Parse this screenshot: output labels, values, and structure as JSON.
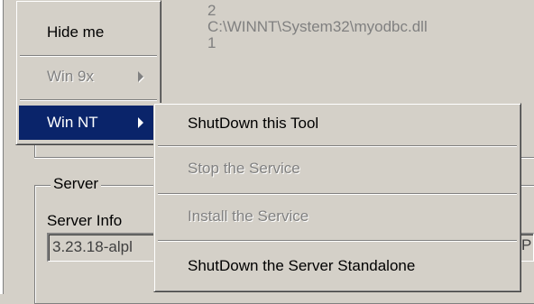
{
  "background": {
    "info_lines": [
      "2",
      "C:\\WINNT\\System32\\myodbc.dll",
      "1"
    ],
    "server_group_label": "Server",
    "server_info_label": "Server Info",
    "version_value": "3.23.18-alpl",
    "right_clip_text": "P"
  },
  "context_menu": {
    "items": [
      {
        "label": "Hide me"
      },
      {
        "label": "Win 9x",
        "disabled": true,
        "has_submenu": true
      },
      {
        "label": "Win NT",
        "selected": true,
        "has_submenu": true
      }
    ]
  },
  "submenu": {
    "items": [
      {
        "label": "ShutDown this Tool"
      },
      {
        "label": "Stop the Service",
        "disabled": true
      },
      {
        "label": "Install the Service",
        "disabled": true
      },
      {
        "label": "ShutDown the Server Standalone"
      }
    ]
  },
  "colors": {
    "face": "#d4d0c8",
    "highlight": "#0a246a",
    "disabled_text": "#808080"
  }
}
